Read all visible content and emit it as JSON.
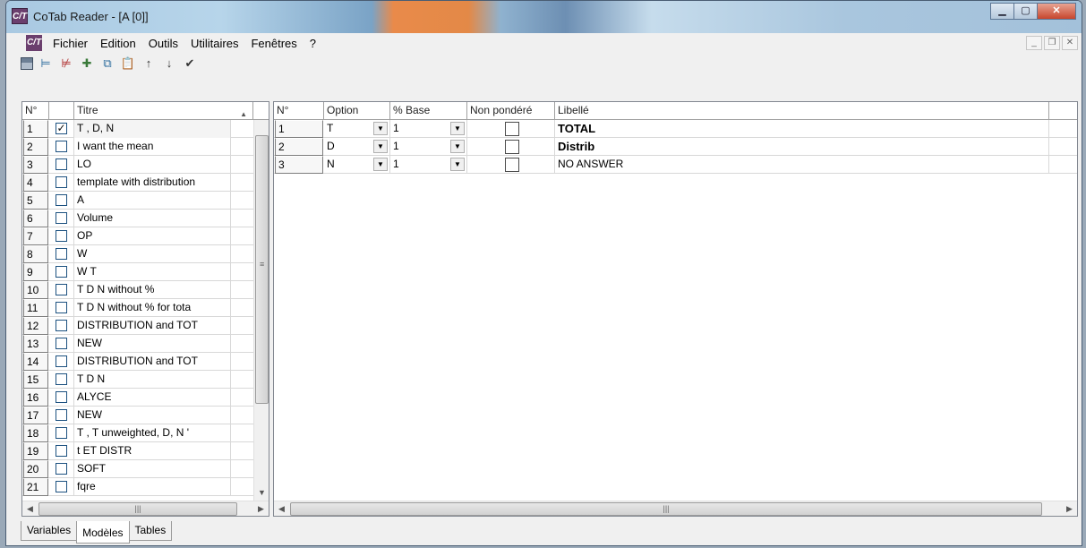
{
  "window": {
    "title": "CoTab Reader - [A [0]]",
    "app_icon": "C/T"
  },
  "menu": {
    "items": [
      "Fichier",
      "Edition",
      "Outils",
      "Utilitaires",
      "Fenêtres",
      "?"
    ]
  },
  "toolbar": {
    "icons": [
      "save-icon",
      "insert-columns-icon",
      "delete-columns-icon",
      "add-icon",
      "copy-icon",
      "paste-icon",
      "move-up-icon",
      "move-down-icon",
      "validate-icon"
    ]
  },
  "left_table": {
    "headers": {
      "num": "N°",
      "check": "",
      "title": "Titre"
    },
    "rows": [
      {
        "n": "1",
        "checked": "✓",
        "titre": "T , D,  N"
      },
      {
        "n": "2",
        "checked": "",
        "titre": "I want the mean"
      },
      {
        "n": "3",
        "checked": "",
        "titre": "LO"
      },
      {
        "n": "4",
        "checked": "",
        "titre": "template with distribution"
      },
      {
        "n": "5",
        "checked": "",
        "titre": "A"
      },
      {
        "n": "6",
        "checked": "",
        "titre": "Volume"
      },
      {
        "n": "7",
        "checked": "",
        "titre": "OP"
      },
      {
        "n": "8",
        "checked": "",
        "titre": "W"
      },
      {
        "n": "9",
        "checked": "",
        "titre": "W T"
      },
      {
        "n": "10",
        "checked": "",
        "titre": "T D N without  %"
      },
      {
        "n": "11",
        "checked": "",
        "titre": "T D N  without %  for tota"
      },
      {
        "n": "12",
        "checked": "",
        "titre": "DISTRIBUTION and TOT"
      },
      {
        "n": "13",
        "checked": "",
        "titre": "NEW"
      },
      {
        "n": "14",
        "checked": "",
        "titre": "DISTRIBUTION and TOT"
      },
      {
        "n": "15",
        "checked": "",
        "titre": "T D N"
      },
      {
        "n": "16",
        "checked": "",
        "titre": "ALYCE"
      },
      {
        "n": "17",
        "checked": "",
        "titre": "NEW"
      },
      {
        "n": "18",
        "checked": "",
        "titre": "T , T unweighted, D,  N  '"
      },
      {
        "n": "19",
        "checked": "",
        "titre": "t ET DISTR"
      },
      {
        "n": "20",
        "checked": "",
        "titre": "SOFT"
      },
      {
        "n": "21",
        "checked": "",
        "titre": "fqre"
      }
    ]
  },
  "right_table": {
    "headers": {
      "num": "N°",
      "option": "Option",
      "base": "% Base",
      "unweighted": "Non pondéré",
      "label": "Libellé"
    },
    "rows": [
      {
        "n": "1",
        "option": "T",
        "base": "1",
        "label": "TOTAL"
      },
      {
        "n": "2",
        "option": "D",
        "base": "1",
        "label": "Distrib"
      },
      {
        "n": "3",
        "option": "N",
        "base": "1",
        "label": "NO ANSWER"
      }
    ]
  },
  "tabs": [
    "Variables",
    "Modèles",
    "Tables"
  ],
  "active_tab": "Modèles"
}
